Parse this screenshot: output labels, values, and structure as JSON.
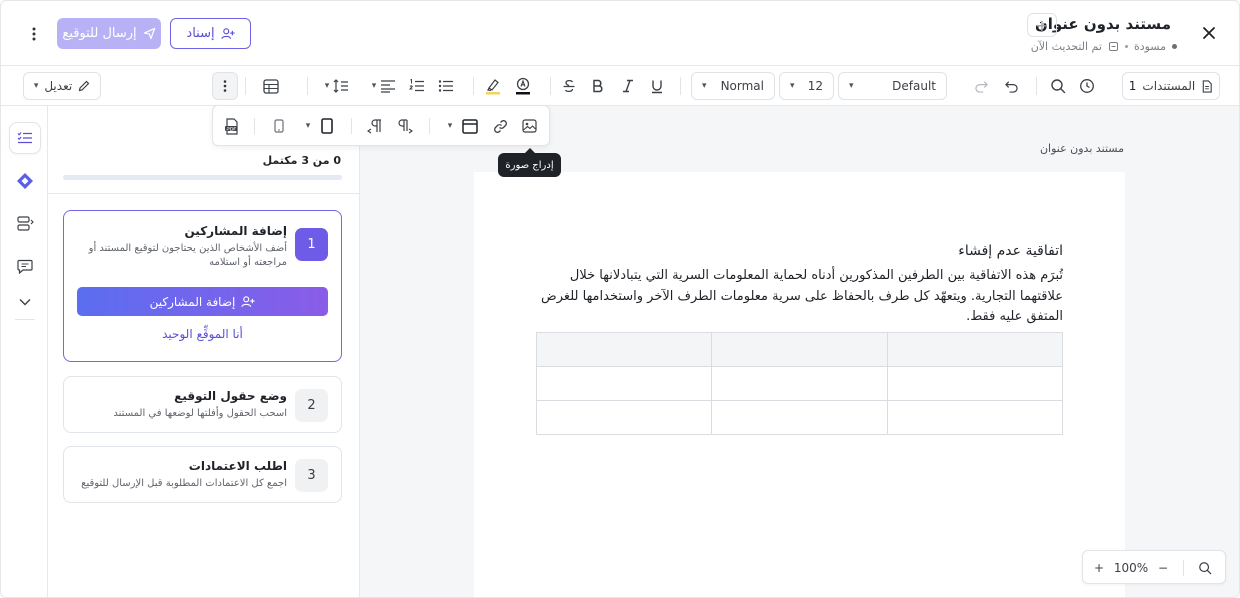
{
  "header": {
    "title": "مستند بدون عنوان",
    "status": "مسودة",
    "saved": "تم التحديث الآن",
    "assign_label": "إسناد",
    "send_label": "إرسال للتوقيع"
  },
  "toolbar": {
    "docs_label": "المستندات",
    "docs_count": "1",
    "font_family": "Default",
    "font_size": "12",
    "paragraph_style": "Normal",
    "edit_mode": "تعديل"
  },
  "floating_toolbar": {
    "tooltip": "إدراج صورة"
  },
  "panel": {
    "progress_text": "0 من 3 مكتمل",
    "progress_fraction": 0,
    "steps": [
      {
        "number": "1",
        "title": "إضافة المشاركين",
        "description": "أضف الأشخاص الذين يحتاجون لتوقيع المستند أو مراجعته أو استلامه",
        "cta": "إضافة المشاركين",
        "link": "أنا الموقِّع الوحيد"
      },
      {
        "number": "2",
        "title": "وضع حقول التوقيع",
        "description": "اسحب الحقول وأفلتها لوضعها في المستند"
      },
      {
        "number": "3",
        "title": "اطلب الاعتمادات",
        "description": "اجمع كل الاعتمادات المطلوبة قبل الإرسال للتوقيع"
      }
    ]
  },
  "document": {
    "page_label": "مستند بدون عنوان",
    "heading": "اتفاقية عدم إفشاء",
    "paragraph": "تُبرَم هذه الاتفاقية بين الطرفين المذكورين أدناه لحماية المعلومات السرية التي يتبادلانها خلال علاقتهما التجارية. ويتعهّد كل طرف بالحفاظ على سرية معلومات الطرف الآخر واستخدامها للغرض المتفق عليه فقط.",
    "table_rows": 3,
    "table_cols": 3
  },
  "zoom": {
    "level": "100%"
  },
  "colors": {
    "accent": "#6e5ce8",
    "accent_light": "#b9b1f5",
    "gradient_start": "#5b6ef0",
    "gradient_end": "#8a5ce8"
  }
}
